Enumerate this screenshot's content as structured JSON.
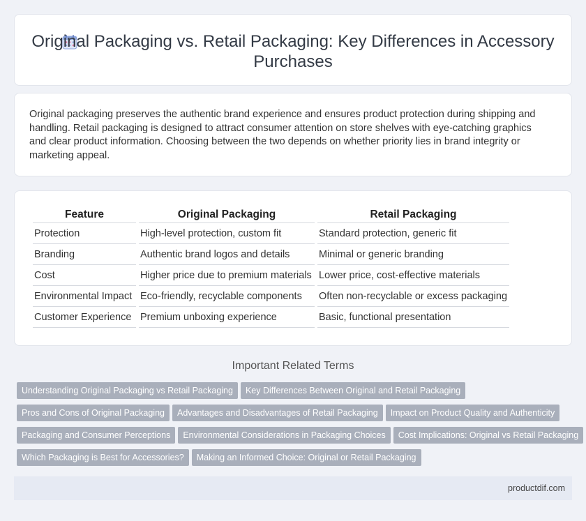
{
  "header": {
    "icon": "calendar-icon",
    "title": "Original Packaging vs. Retail Packaging: Key Differences in Accessory Purchases"
  },
  "intro": {
    "text": "Original packaging preserves the authentic brand experience and ensures product protection during shipping and handling. Retail packaging is designed to attract consumer attention on store shelves with eye-catching graphics and clear product information. Choosing between the two depends on whether priority lies in brand integrity or marketing appeal."
  },
  "table": {
    "headers": [
      "Feature",
      "Original Packaging",
      "Retail Packaging"
    ],
    "rows": [
      [
        "Protection",
        "High-level protection, custom fit",
        "Standard protection, generic fit"
      ],
      [
        "Branding",
        "Authentic brand logos and details",
        "Minimal or generic branding"
      ],
      [
        "Cost",
        "Higher price due to premium materials",
        "Lower price, cost-effective materials"
      ],
      [
        "Environmental Impact",
        "Eco-friendly, recyclable components",
        "Often non-recyclable or excess packaging"
      ],
      [
        "Customer Experience",
        "Premium unboxing experience",
        "Basic, functional presentation"
      ]
    ]
  },
  "related": {
    "title": "Important Related Terms",
    "tag_rows": [
      [
        "Understanding Original Packaging vs Retail Packaging",
        "Key Differences Between Original and Retail Packaging"
      ],
      [
        "Pros and Cons of Original Packaging",
        "Advantages and Disadvantages of Retail Packaging",
        "Impact on Product Quality and Authenticity"
      ],
      [
        "Packaging and Consumer Perceptions",
        "Environmental Considerations in Packaging Choices",
        "Cost Implications: Original vs Retail Packaging"
      ],
      [
        "Which Packaging is Best for Accessories?",
        "Making an Informed Choice: Original or Retail Packaging"
      ]
    ]
  },
  "footer": {
    "site": "productdif.com"
  },
  "colors": {
    "background": "#f0f2f7",
    "tag": "#a9afbb",
    "footer": "#e6eaf3"
  }
}
